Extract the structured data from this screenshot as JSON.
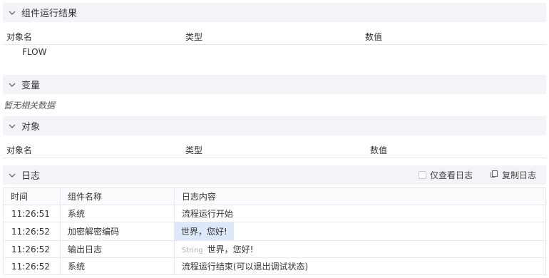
{
  "sections": {
    "result": {
      "title": "组件运行结果",
      "columns": [
        "对象名",
        "类型",
        "数值"
      ],
      "rows": [
        {
          "name": "FLOW"
        }
      ]
    },
    "variables": {
      "title": "变量",
      "empty_text": "暂无相关数据"
    },
    "objects": {
      "title": "对象",
      "columns": [
        "对象名",
        "类型",
        "数值"
      ]
    },
    "log": {
      "title": "日志",
      "only_view_log_label": "仅查看日志",
      "copy_log_label": "复制日志",
      "columns": [
        "时间",
        "组件名称",
        "日志内容"
      ],
      "rows": [
        {
          "time": "11:26:51",
          "component": "系统",
          "content": "流程运行开始"
        },
        {
          "time": "11:26:52",
          "component": "加密解密编码",
          "content": "世界，您好!"
        },
        {
          "time": "11:26:52",
          "component": "输出日志",
          "type_tag": "String",
          "content": "世界，您好!"
        },
        {
          "time": "11:26:52",
          "component": "系统",
          "content": "流程运行结束(可以退出调试状态)"
        }
      ]
    }
  },
  "colors": {
    "section_bg": "#f2f4f8",
    "highlight_bg": "#dde8fb",
    "border": "#e6e8ec"
  },
  "icons": {
    "collapse": "chevron-down-icon",
    "checkbox": "checkbox-icon",
    "copy": "copy-icon"
  }
}
